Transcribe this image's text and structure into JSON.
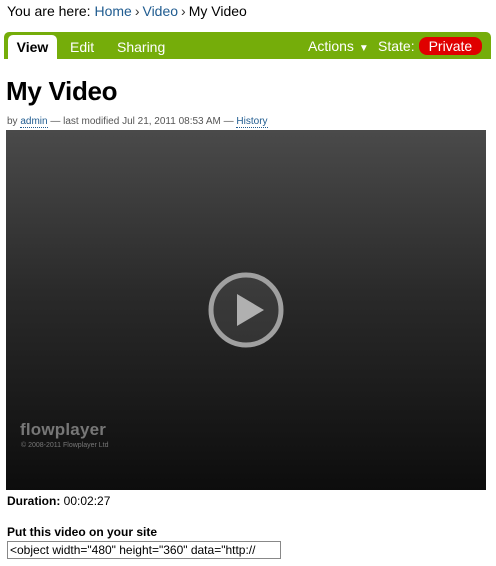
{
  "breadcrumb": {
    "prefix": "You are here:",
    "items": [
      "Home",
      "Video",
      "My Video"
    ],
    "separator": "›"
  },
  "toolbar": {
    "tabs": [
      "View",
      "Edit",
      "Sharing"
    ],
    "active_tab": "View",
    "actions_label": "Actions",
    "state_label": "State:",
    "state_value": "Private",
    "caret": "▼",
    "colors": {
      "bar": "#75ad0a",
      "state_badge": "#e00000"
    }
  },
  "page": {
    "title": "My Video",
    "byline": {
      "by": "by",
      "author": "admin",
      "modified": "— last modified Jul 21, 2011 08:53 AM —",
      "history": "History"
    }
  },
  "player": {
    "brand": "flowplayer",
    "copyright": "© 2008-2011 Flowplayer Ltd",
    "icon": "play-icon"
  },
  "duration": {
    "label": "Duration:",
    "value": "00:02:27"
  },
  "embed": {
    "label": "Put this video on your site",
    "value": "<object width=\"480\" height=\"360\" data=\"http://"
  }
}
